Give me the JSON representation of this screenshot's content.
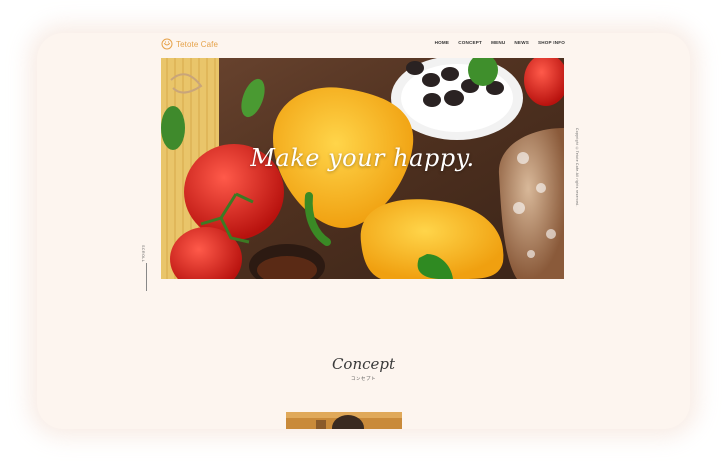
{
  "header": {
    "logo_text": "Tetote Cafe",
    "nav": [
      "HOME",
      "CONCEPT",
      "MENU",
      "NEWS",
      "SHOP INFO"
    ]
  },
  "hero": {
    "headline": "Make your happy."
  },
  "side": {
    "scroll_label": "SCROLL",
    "copyright": "Copyright ©Tetote Cafe.All rights reserved."
  },
  "concept": {
    "title": "Concept",
    "subtitle": "コンセプト"
  },
  "colors": {
    "page_background": "#fdf5ef",
    "accent": "#e6a24a",
    "text": "#333333"
  },
  "icons": {
    "logo": "smile-logo-icon"
  }
}
